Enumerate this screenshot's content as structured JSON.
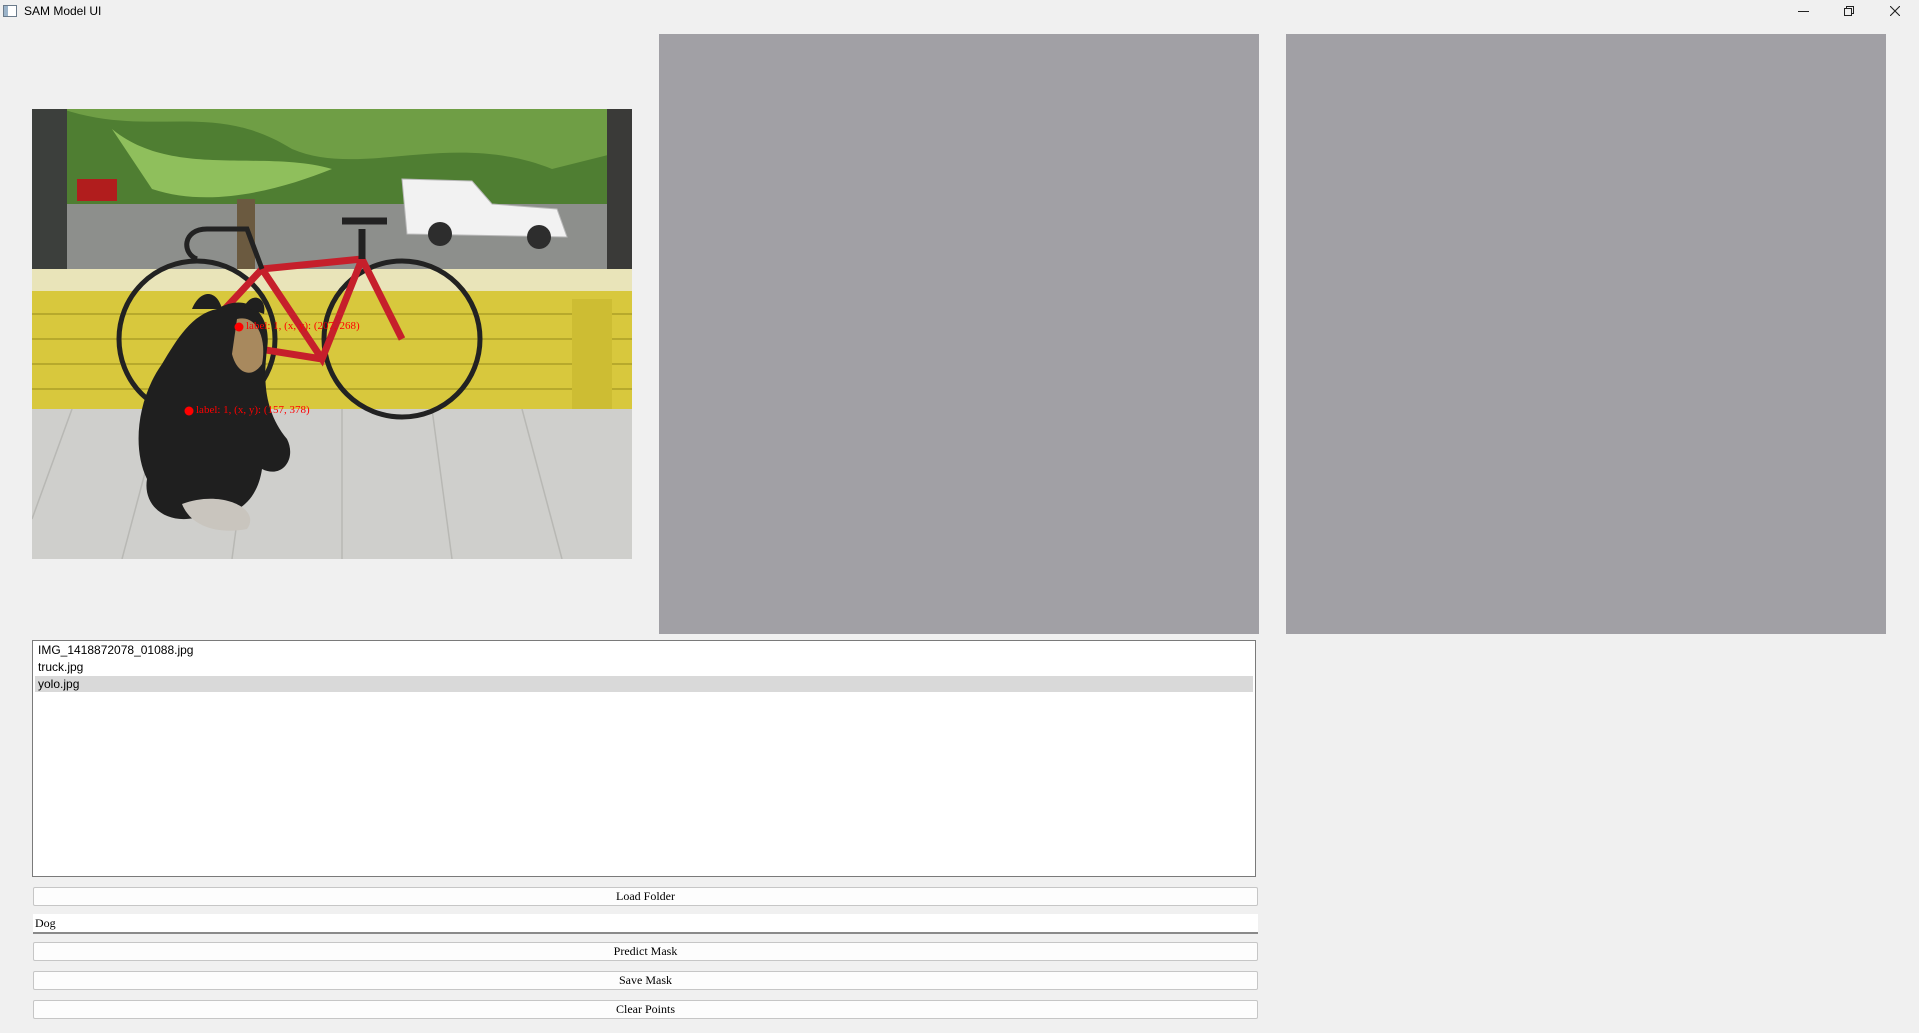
{
  "window": {
    "title": "SAM Model UI",
    "icon": "app-window-icon"
  },
  "controls": {
    "minimize": "minimize-icon",
    "maximize": "restore-icon",
    "close": "close-icon"
  },
  "image_viewer": {
    "points": [
      {
        "label": "label: 1, (x, y): (207, 268)"
      },
      {
        "label": "label: 1, (x, y): (157, 378)"
      }
    ]
  },
  "files": [
    "IMG_1418872078_01088.jpg",
    "truck.jpg",
    "yolo.jpg"
  ],
  "selected_file": "yolo.jpg",
  "buttons": {
    "load_folder": "Load Folder",
    "predict_mask": "Predict Mask",
    "save_mask": "Save Mask",
    "clear_points": "Clear Points"
  },
  "prompt": {
    "value": "Dog"
  },
  "colors": {
    "preview_bg": "#a1a0a5",
    "point": "#ff0000",
    "selected_row": "#d9d9d9"
  }
}
